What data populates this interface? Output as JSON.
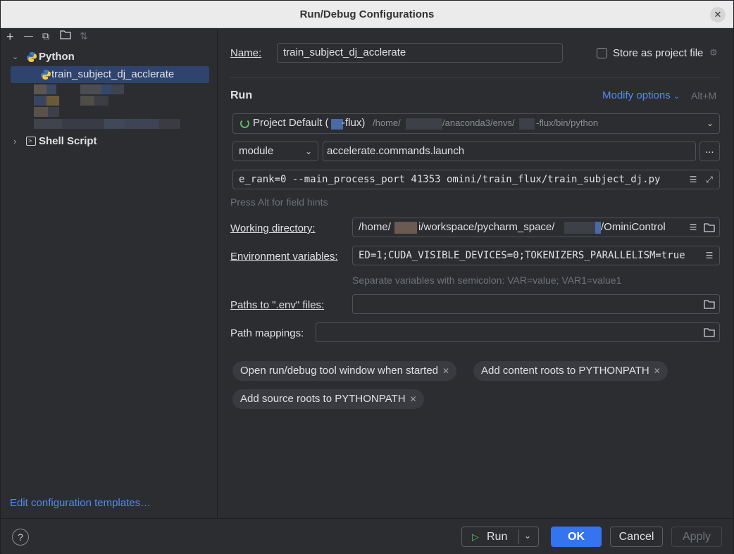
{
  "window": {
    "title": "Run/Debug Configurations",
    "close_icon": "close-icon"
  },
  "toolbar": {
    "add": "+",
    "remove": "—",
    "copy": "⧉",
    "folder": "📁",
    "sort": "⇅"
  },
  "tree": {
    "python_label": "Python",
    "python_item": "train_subject_dj_acclerate",
    "shell_label": "Shell Script"
  },
  "left_footer": {
    "edit_templates": "Edit configuration templates…"
  },
  "form": {
    "name_label": "Name:",
    "name_value": "train_subject_dj_acclerate",
    "store_label": "Store as project file",
    "run_header": "Run",
    "modify_options": "Modify options",
    "modify_shortcut": "Alt+M",
    "interpreter_main": "Project Default (",
    "interpreter_env": "-flux)",
    "interpreter_path_a": "/home/",
    "interpreter_path_b": "/anaconda3/envs/",
    "interpreter_path_c": "-flux/bin/python",
    "module_select": "module",
    "module_value": "accelerate.commands.launch",
    "more_button": "...",
    "params_value": "e_rank=0 --main_process_port 41353 omini/train_flux/train_subject_dj.py",
    "alt_hint": "Press Alt for field hints",
    "workdir_label": "Working directory:",
    "workdir_a": "/home/",
    "workdir_b": "i/workspace/pycharm_space/",
    "workdir_c": "/OminiControl",
    "env_label": "Environment variables:",
    "env_value": "ED=1;CUDA_VISIBLE_DEVICES=0;TOKENIZERS_PARALLELISM=true",
    "env_hint": "Separate variables with semicolon: VAR=value; VAR1=value1",
    "dotenv_label": "Paths to \".env\" files:",
    "mappings_label": "Path mappings:"
  },
  "chips": [
    {
      "label": "Open run/debug tool window when started"
    },
    {
      "label": "Add content roots to PYTHONPATH"
    },
    {
      "label": "Add source roots to PYTHONPATH"
    }
  ],
  "footer": {
    "help": "?",
    "run": "Run",
    "ok": "OK",
    "cancel": "Cancel",
    "apply": "Apply"
  },
  "colors": {
    "accent": "#3574f0",
    "link": "#548af7",
    "selection": "#2e436e"
  }
}
